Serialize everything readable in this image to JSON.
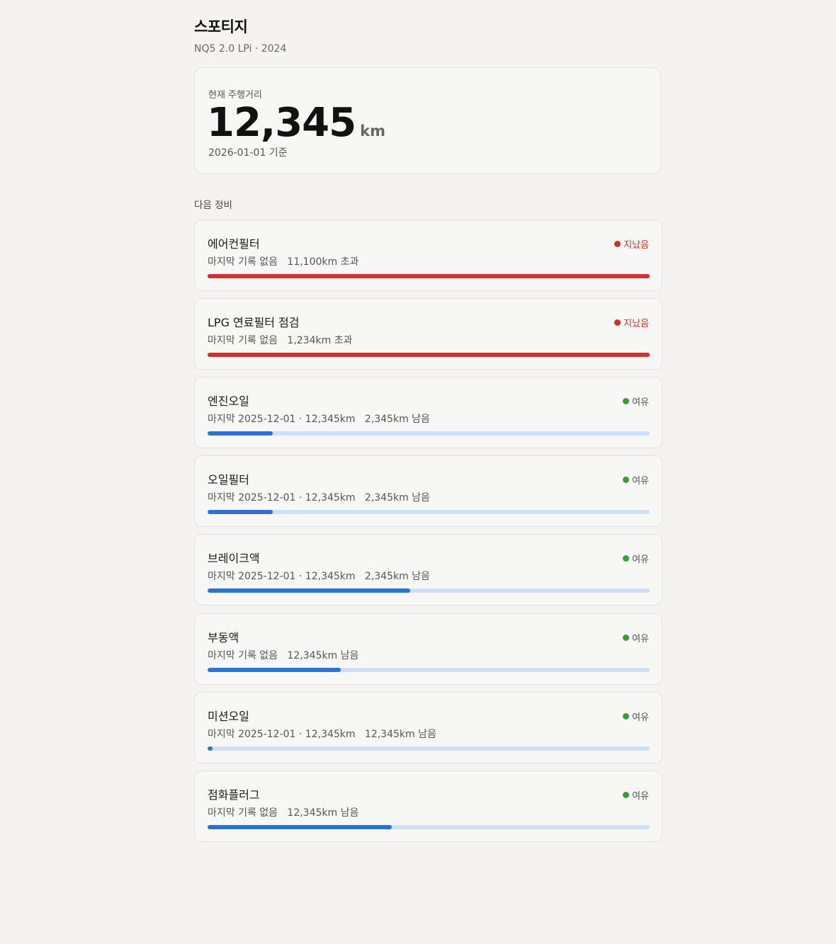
{
  "header": {
    "car_name": "스포티지",
    "car_sub": "NQ5 2.0 LPi · 2024"
  },
  "odometer": {
    "label": "현재 주행거리",
    "value": "12,345",
    "unit": "km",
    "as_of": "2026-01-01 기준"
  },
  "section_label": "다음 정비",
  "colors": {
    "overdue": "#d0302f",
    "ok": "#3a9d3a",
    "bar_normal": "#2b72d6",
    "bar_overdue": "#d0302f",
    "track_normal": "#cfdff4",
    "track_overdue": "#d0302f"
  },
  "items": [
    {
      "title": "에어컨필터",
      "status": "지났음",
      "overdue": true,
      "last": "마지막 기록 없음",
      "remaining": "11,100km 초과",
      "progress": 1.0
    },
    {
      "title": "LPG 연료필터 점검",
      "status": "지났음",
      "overdue": true,
      "last": "마지막 기록 없음",
      "remaining": "1,234km 초과",
      "progress": 1.0
    },
    {
      "title": "엔진오일",
      "status": "여유",
      "overdue": false,
      "last": "마지막 2025-12-01 · 12,345km",
      "remaining": "2,345km 남음",
      "progress": 0.147
    },
    {
      "title": "오일필터",
      "status": "여유",
      "overdue": false,
      "last": "마지막 2025-12-01 · 12,345km",
      "remaining": "2,345km 남음",
      "progress": 0.147
    },
    {
      "title": "브레이크액",
      "status": "여유",
      "overdue": false,
      "last": "마지막 2025-12-01 · 12,345km",
      "remaining": "2,345km 남음",
      "progress": 0.459
    },
    {
      "title": "부동액",
      "status": "여유",
      "overdue": false,
      "last": "마지막 기록 없음",
      "remaining": "12,345km 남음",
      "progress": 0.302
    },
    {
      "title": "미션오일",
      "status": "여유",
      "overdue": false,
      "last": "마지막 2025-12-01 · 12,345km",
      "remaining": "12,345km 남음",
      "progress": 0.011
    },
    {
      "title": "점화플러그",
      "status": "여유",
      "overdue": false,
      "last": "마지막 기록 없음",
      "remaining": "12,345km 남음",
      "progress": 0.417
    }
  ]
}
